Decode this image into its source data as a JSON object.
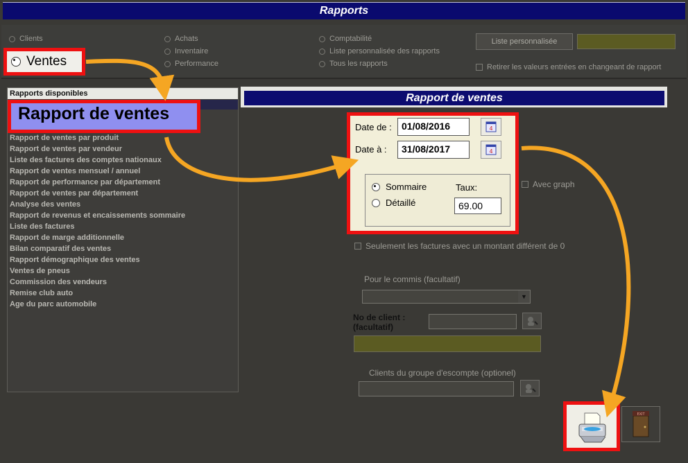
{
  "window": {
    "title": "Rapports"
  },
  "report_types": {
    "clients": "Clients",
    "ventes": "Ventes",
    "achats": "Achats",
    "inventaire": "Inventaire",
    "performance": "Performance",
    "comptabilite": "Comptabilité",
    "liste_perso": "Liste personnalisée des rapports",
    "tous": "Tous les rapports",
    "selected": "Ventes"
  },
  "top": {
    "custom_list_button": "Liste personnalisée",
    "custom_list_value": "",
    "reset_checkbox": "Retirer les valeurs entrées en changeant de rapport"
  },
  "available_reports": {
    "header": "Rapports disponibles",
    "selected": "Rapport de ventes",
    "items": [
      "Rapport de ventes par produit",
      "Rapport de ventes par vendeur",
      "Liste des factures des comptes nationaux",
      "Rapport de ventes mensuel / annuel",
      "Rapport de performance par département",
      "Rapport de ventes par département",
      "Analyse des ventes",
      "Rapport de revenus et encaissements sommaire",
      "Liste des factures",
      "Rapport de marge additionnelle",
      "Bilan comparatif des ventes",
      "Rapport démographique des ventes",
      "Ventes de pneus",
      "Commission des vendeurs",
      "Remise club auto",
      "Age du parc automobile"
    ]
  },
  "report_panel": {
    "title": "Rapport de ventes",
    "date_from_label": "Date de :",
    "date_from_value": "01/08/2016",
    "date_to_label": "Date à :",
    "date_to_value": "31/08/2017",
    "mode_summary": "Sommaire",
    "mode_detail": "Détaillé",
    "mode_selected": "Sommaire",
    "rate_label": "Taux:",
    "rate_value": "69.00",
    "with_graph": "Avec graph",
    "nonzero_only": "Seulement les factures avec un montant différent de 0",
    "commis_label": "Pour le commis (facultatif)",
    "commis_value": "",
    "client_label_1": "No de client :",
    "client_label_2": "(facultatif)",
    "client_value": "",
    "discount_group_label": "Clients du groupe d'escompte (optionel)",
    "discount_group_value": "",
    "exit_label": "EXIT"
  },
  "colors": {
    "title_bar": "#0a0a6e",
    "highlight": "#ee1111",
    "arrow": "#f5a623",
    "selection": "#8f8ff0"
  }
}
